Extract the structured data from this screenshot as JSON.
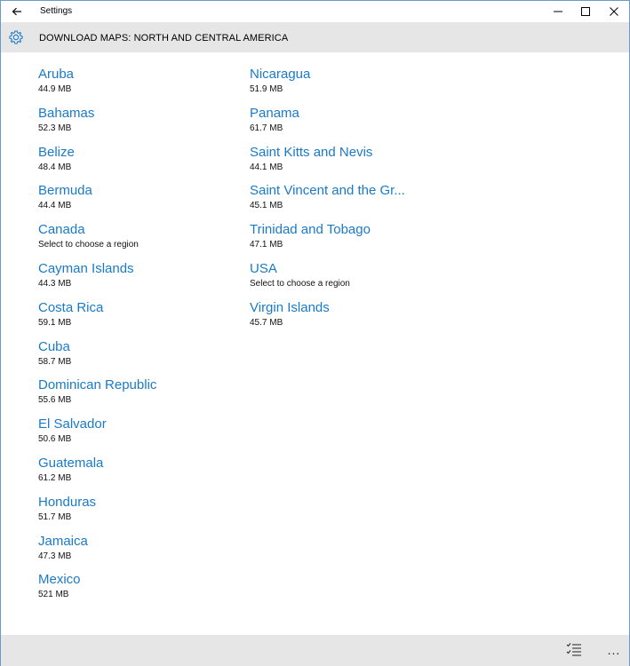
{
  "window": {
    "title": "Settings"
  },
  "header": {
    "title": "DOWNLOAD MAPS: NORTH AND CENTRAL AMERICA"
  },
  "icons": {
    "back": "back-arrow-icon",
    "settings": "gear-icon",
    "minimize": "minimize-icon",
    "maximize": "maximize-icon",
    "close": "close-icon",
    "select_list": "checklist-icon",
    "more": "more-icon"
  },
  "colors": {
    "accent": "#1a7ac7",
    "header_bg": "#e6e6e6"
  },
  "countries_col1": [
    {
      "name": "Aruba",
      "size": "44.9 MB"
    },
    {
      "name": "Bahamas",
      "size": "52.3 MB"
    },
    {
      "name": "Belize",
      "size": "48.4 MB"
    },
    {
      "name": "Bermuda",
      "size": "44.4 MB"
    },
    {
      "name": "Canada",
      "size": "Select to choose a region"
    },
    {
      "name": "Cayman Islands",
      "size": "44.3 MB"
    },
    {
      "name": "Costa Rica",
      "size": "59.1 MB"
    },
    {
      "name": "Cuba",
      "size": "58.7 MB"
    },
    {
      "name": "Dominican Republic",
      "size": "55.6 MB"
    },
    {
      "name": "El Salvador",
      "size": "50.6 MB"
    },
    {
      "name": "Guatemala",
      "size": "61.2 MB"
    },
    {
      "name": "Honduras",
      "size": "51.7 MB"
    },
    {
      "name": "Jamaica",
      "size": "47.3 MB"
    },
    {
      "name": "Mexico",
      "size": "521 MB"
    }
  ],
  "countries_col2": [
    {
      "name": "Nicaragua",
      "size": "51.9 MB"
    },
    {
      "name": "Panama",
      "size": "61.7 MB"
    },
    {
      "name": "Saint Kitts and Nevis",
      "size": "44.1 MB"
    },
    {
      "name": "Saint Vincent and the Gr...",
      "size": "45.1 MB"
    },
    {
      "name": "Trinidad and Tobago",
      "size": "47.1 MB"
    },
    {
      "name": "USA",
      "size": "Select to choose a region"
    },
    {
      "name": "Virgin Islands",
      "size": "45.7 MB"
    }
  ],
  "appbar": {
    "more_label": "..."
  }
}
